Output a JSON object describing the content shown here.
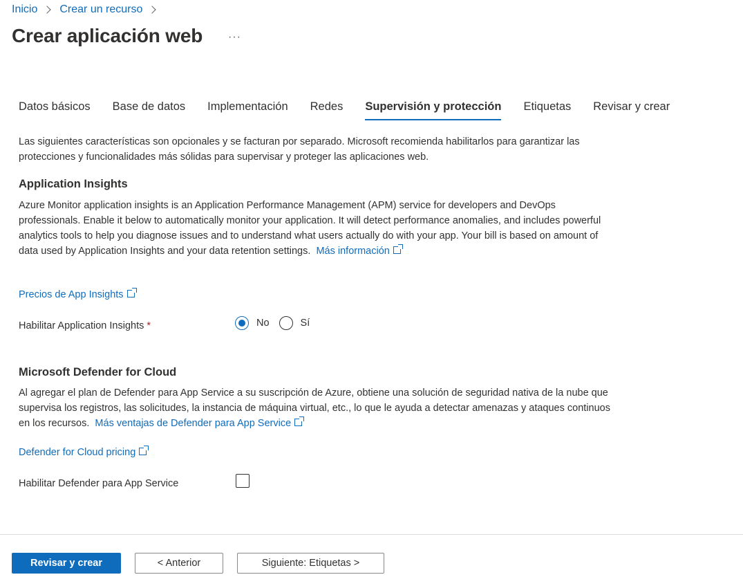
{
  "breadcrumb": {
    "home": "Inicio",
    "create": "Crear un recurso"
  },
  "page": {
    "title": "Crear aplicación web",
    "more": "···"
  },
  "tabs": [
    {
      "label": "Datos básicos"
    },
    {
      "label": "Base de datos"
    },
    {
      "label": "Implementación"
    },
    {
      "label": "Redes"
    },
    {
      "label": "Supervisión y protección",
      "active": true
    },
    {
      "label": "Etiquetas"
    },
    {
      "label": "Revisar y crear"
    }
  ],
  "intro": "Las siguientes características son opcionales y se facturan por separado. Microsoft recomienda habilitarlos para garantizar las protecciones y funcionalidades más sólidas para supervisar y proteger las aplicaciones web.",
  "app_insights": {
    "title": "Application Insights",
    "description": "Azure Monitor application insights is an Application Performance Management (APM) service for developers and DevOps professionals. Enable it below to automatically monitor your application. It will detect performance anomalies, and includes powerful analytics tools to help you diagnose issues and to understand what users actually do with your app. Your bill is based on amount of data used by Application Insights and your data retention settings.",
    "more_link": "Más información",
    "pricing_link": "Precios de App Insights",
    "enable_label": "Habilitar Application Insights",
    "required_mark": "*",
    "option_no": "No",
    "option_yes": "Sí",
    "selected": "No"
  },
  "defender": {
    "title": "Microsoft Defender for Cloud",
    "description": "Al agregar el plan de Defender para App Service a su suscripción de Azure, obtiene una solución de seguridad nativa de la nube que supervisa los registros, las solicitudes, la instancia de máquina virtual, etc., lo que le ayuda a detectar amenazas y ataques continuos en los recursos.",
    "benefits_link": "Más ventajas de Defender para App Service",
    "pricing_link": "Defender for Cloud pricing",
    "enable_label": "Habilitar Defender para App Service",
    "enabled": false
  },
  "footer": {
    "review_create": "Revisar y crear",
    "previous": "< Anterior",
    "next": "Siguiente: Etiquetas >"
  },
  "colors": {
    "accent": "#0f6cbd",
    "text": "#323130",
    "required": "#a4262c"
  }
}
